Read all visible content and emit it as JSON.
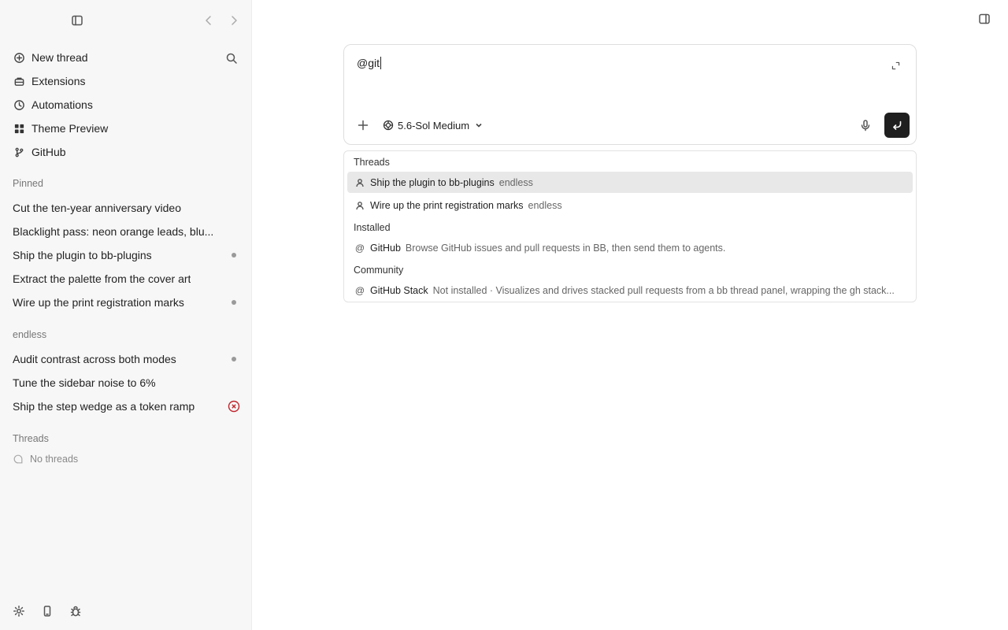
{
  "sidebar": {
    "nav": [
      {
        "label": "New thread",
        "icon": "plus-circle-icon"
      },
      {
        "label": "Extensions",
        "icon": "extensions-icon"
      },
      {
        "label": "Automations",
        "icon": "clock-icon"
      },
      {
        "label": "Theme Preview",
        "icon": "grid-icon"
      },
      {
        "label": "GitHub",
        "icon": "github-icon"
      }
    ],
    "pinned_label": "Pinned",
    "pinned": [
      {
        "label": "Cut the ten-year anniversary video"
      },
      {
        "label": "Blacklight pass: neon orange leads, blu..."
      },
      {
        "label": "Ship the plugin to bb-plugins",
        "status": "dot"
      },
      {
        "label": "Extract the palette from the cover art"
      },
      {
        "label": "Wire up the print registration marks",
        "status": "dot"
      }
    ],
    "project_label": "endless",
    "project": [
      {
        "label": "Audit contrast across both modes",
        "status": "dot"
      },
      {
        "label": "Tune the sidebar noise to 6%"
      },
      {
        "label": "Ship the step wedge as a token ramp",
        "status": "error"
      }
    ],
    "threads_label": "Threads",
    "no_threads": "No threads"
  },
  "composer": {
    "value": "@git",
    "model": "5.6-Sol Medium"
  },
  "dropdown": {
    "threads_header": "Threads",
    "threads": [
      {
        "name": "Ship the plugin to bb-plugins",
        "meta": "endless",
        "selected": true
      },
      {
        "name": "Wire up the print registration marks",
        "meta": "endless"
      }
    ],
    "installed_header": "Installed",
    "installed": [
      {
        "name": "GitHub",
        "meta": "Browse GitHub issues and pull requests in BB, then send them to agents."
      }
    ],
    "community_header": "Community",
    "community": [
      {
        "name": "GitHub Stack",
        "meta": "Not installed · Visualizes and drives stacked pull requests from a bb thread panel, wrapping the gh stack..."
      }
    ]
  },
  "colors": {
    "sidebar_bg": "#f7f7f7",
    "selected_row": "#e8e8e8",
    "send_button": "#1f1f1f",
    "error": "#c0262d"
  }
}
